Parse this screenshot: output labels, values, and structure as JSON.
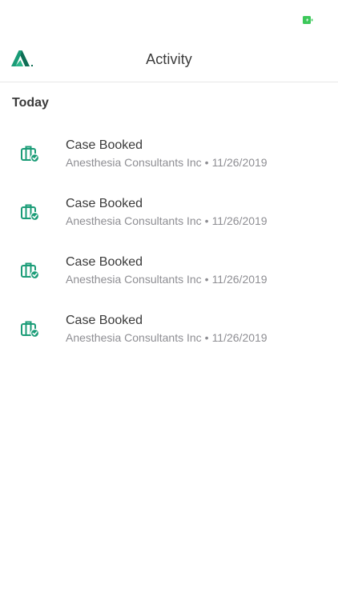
{
  "colors": {
    "accent": "#1a9c77",
    "accent_dark": "#0f6e55",
    "battery": "#3cc85a",
    "title_text": "#3a3a3a",
    "subtitle_text": "#8e8e93"
  },
  "status_bar": {
    "battery_icon": "battery-charging-icon"
  },
  "nav": {
    "logo_icon": "app-logo-icon",
    "title": "Activity"
  },
  "section": {
    "title": "Today"
  },
  "activities": [
    {
      "icon": "briefcase-check-icon",
      "title": "Case Booked",
      "organization": "Anesthesia Consultants Inc",
      "separator": "•",
      "date": "11/26/2019"
    },
    {
      "icon": "briefcase-check-icon",
      "title": "Case Booked",
      "organization": "Anesthesia Consultants Inc",
      "separator": "•",
      "date": "11/26/2019"
    },
    {
      "icon": "briefcase-check-icon",
      "title": "Case Booked",
      "organization": "Anesthesia Consultants Inc",
      "separator": "•",
      "date": "11/26/2019"
    },
    {
      "icon": "briefcase-check-icon",
      "title": "Case Booked",
      "organization": "Anesthesia Consultants Inc",
      "separator": "•",
      "date": "11/26/2019"
    }
  ]
}
